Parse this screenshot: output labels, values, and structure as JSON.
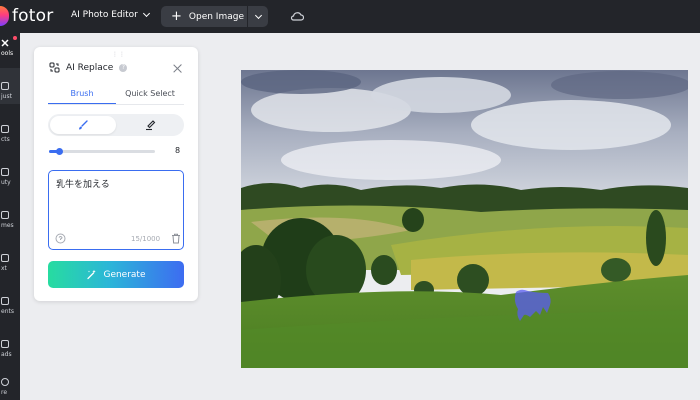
{
  "topbar": {
    "logo_text": "fotor",
    "editor_menu": "AI Photo Editor",
    "open_image_label": "Open Image",
    "icons": [
      "chevron-down-icon",
      "plus-icon",
      "cloud-icon"
    ]
  },
  "sidebar": {
    "items": [
      {
        "label": "ools",
        "icon": "tools-icon",
        "active": true
      },
      {
        "label": "just",
        "icon": "adjust-icon"
      },
      {
        "label": "cts",
        "icon": "effects-icon"
      },
      {
        "label": "uty",
        "icon": "beauty-icon"
      },
      {
        "label": "mes",
        "icon": "frames-icon"
      },
      {
        "label": "xt",
        "icon": "text-icon"
      },
      {
        "label": "ents",
        "icon": "elements-icon"
      },
      {
        "label": "ads",
        "icon": "uploads-icon"
      },
      {
        "label": "re",
        "icon": "more-icon"
      }
    ]
  },
  "panel": {
    "title": "AI Replace",
    "tabs": [
      {
        "label": "Brush",
        "active": true
      },
      {
        "label": "Quick Select",
        "active": false
      }
    ],
    "mode": {
      "selected": "brush",
      "options": [
        "brush-icon",
        "eraser-icon"
      ]
    },
    "brush_size": {
      "value": 8,
      "fraction": 0.1,
      "label": "8"
    },
    "prompt": {
      "value": "乳牛を加える",
      "count": "15/1000"
    },
    "generate_label": "Generate"
  },
  "colors": {
    "accent": "#3a6df0",
    "topbar_bg": "#23252a",
    "canvas_bg": "#ecedf0",
    "mask": "#5a5cf0"
  }
}
